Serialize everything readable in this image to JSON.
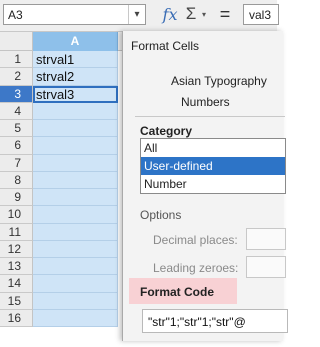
{
  "formula_bar": {
    "name_box_value": "A3",
    "name_box_dropdown_icon": "chevron-down-icon",
    "function_wizard_icon": "fx",
    "sum_icon": "Σ",
    "sum_dropdown_icon": "▾",
    "equals_icon": "=",
    "input_value": "val3"
  },
  "sheet": {
    "column_header": "A",
    "row_numbers": [
      "1",
      "2",
      "3",
      "4",
      "5",
      "6",
      "7",
      "8",
      "9",
      "10",
      "11",
      "12",
      "13",
      "14",
      "15",
      "16"
    ],
    "active_row": "3",
    "cells": [
      "strval1",
      "strval2",
      "strval3",
      "",
      "",
      "",
      "",
      "",
      "",
      "",
      "",
      "",
      "",
      "",
      "",
      ""
    ],
    "colors": {
      "selection": "#cfe4f7",
      "header_selected": "#8ec0ea",
      "active_row_header": "#3d78c8"
    }
  },
  "dialog": {
    "title": "Format Cells",
    "tabs": [
      "Asian Typography",
      "Numbers"
    ],
    "active_tab": "Numbers",
    "category_label": "Category",
    "categories": [
      "All",
      "User-defined",
      "Number"
    ],
    "selected_category": "User-defined",
    "options_label": "Options",
    "decimal_places_label": "Decimal places:",
    "leading_zeroes_label": "Leading zeroes:",
    "format_code_label": "Format Code",
    "format_code_value": "\"str\"1;\"str\"1;\"str\"@",
    "colors": {
      "selected": "#2d74c7",
      "format_code_highlight": "#f8d1d4"
    }
  }
}
